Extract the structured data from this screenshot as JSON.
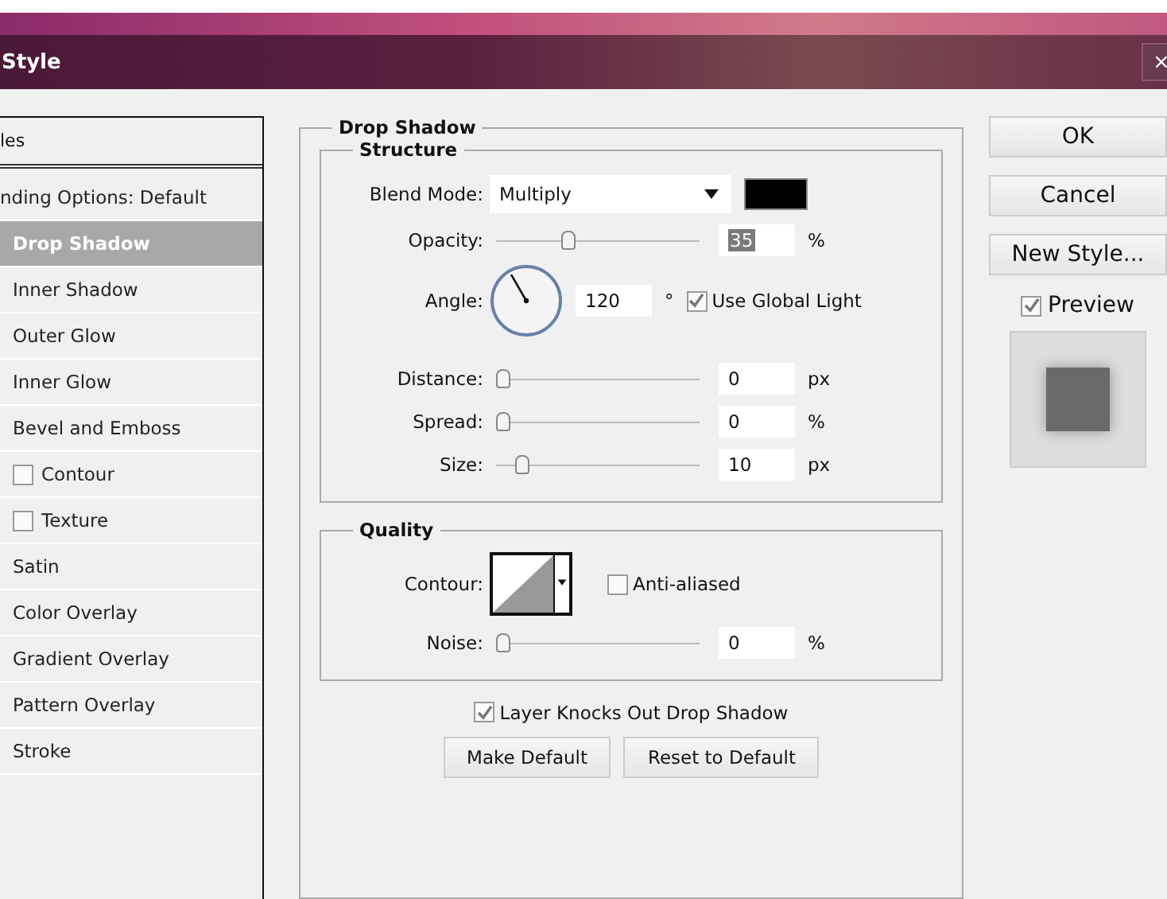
{
  "window": {
    "title": "Style",
    "close": "×"
  },
  "styles_list": {
    "header": "les",
    "items": [
      {
        "label": "nding Options: Default",
        "kind": "plain",
        "selected": false
      },
      {
        "label": "Drop Shadow",
        "kind": "plain",
        "selected": true
      },
      {
        "label": "Inner Shadow",
        "kind": "plain",
        "selected": false
      },
      {
        "label": "Outer Glow",
        "kind": "plain",
        "selected": false
      },
      {
        "label": "Inner Glow",
        "kind": "plain",
        "selected": false
      },
      {
        "label": "Bevel and Emboss",
        "kind": "plain",
        "selected": false
      },
      {
        "label": "Contour",
        "kind": "check",
        "checked": false,
        "selected": false
      },
      {
        "label": "Texture",
        "kind": "check",
        "checked": false,
        "selected": false
      },
      {
        "label": "Satin",
        "kind": "plain",
        "selected": false
      },
      {
        "label": "Color Overlay",
        "kind": "plain",
        "selected": false
      },
      {
        "label": "Gradient Overlay",
        "kind": "plain",
        "selected": false
      },
      {
        "label": "Pattern Overlay",
        "kind": "plain",
        "selected": false
      },
      {
        "label": "Stroke",
        "kind": "plain",
        "selected": false
      }
    ]
  },
  "drop_shadow": {
    "title": "Drop Shadow",
    "structure": {
      "title": "Structure",
      "blend_mode": {
        "label": "Blend Mode:",
        "value": "Multiply",
        "color": "#000000"
      },
      "opacity": {
        "label": "Opacity:",
        "level": 0.35,
        "value": "35",
        "unit": "%",
        "selected": true
      },
      "angle": {
        "label": "Angle:",
        "value": "120",
        "unit": "°",
        "use_global_light": {
          "label": "Use Global Light",
          "checked": true
        }
      },
      "sliders": [
        {
          "label": "Distance:",
          "level": 0,
          "value": "0",
          "unit": "px",
          "selected": false
        },
        {
          "label": "Spread:",
          "level": 0,
          "value": "0",
          "unit": "%",
          "selected": false
        },
        {
          "label": "Size:",
          "level": 0.1,
          "value": "10",
          "unit": "px",
          "selected": false
        }
      ]
    },
    "quality": {
      "title": "Quality",
      "contour_label": "Contour:",
      "anti_aliased": {
        "label": "Anti-aliased",
        "checked": false
      },
      "noise": {
        "label": "Noise:",
        "level": 0,
        "value": "0",
        "unit": "%",
        "selected": false
      }
    },
    "layer_knocks_out": {
      "label": "Layer Knocks Out Drop Shadow",
      "checked": true
    },
    "buttons": [
      "Make Default",
      "Reset to Default"
    ]
  },
  "side_buttons": [
    "OK",
    "Cancel",
    "New Style..."
  ],
  "preview": {
    "label": "Preview",
    "checked": true
  }
}
